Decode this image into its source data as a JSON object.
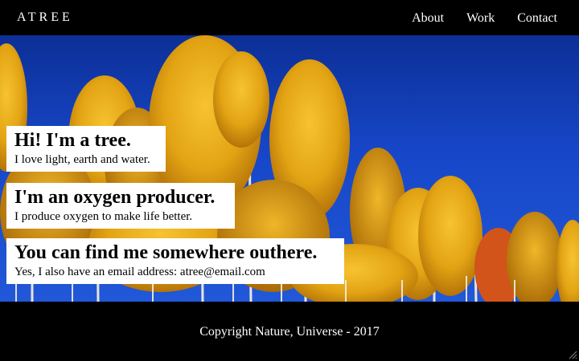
{
  "header": {
    "brand": "ATREE",
    "nav": [
      "About",
      "Work",
      "Contact"
    ]
  },
  "hero": {
    "cards": [
      {
        "title": "Hi! I'm a tree.",
        "text": "I love light, earth and water."
      },
      {
        "title": "I'm an oxygen producer.",
        "text": "I produce oxygen to make life better."
      },
      {
        "title": "You can find me somewhere outhere.",
        "text": "Yes, I also have an email address: atree@email.com"
      }
    ]
  },
  "footer": {
    "copyright": "Copyright Nature, Universe - 2017"
  },
  "colors": {
    "sky": "#1747c9",
    "foliage": "#e5a612",
    "foliage_dark": "#c57c07",
    "bars": "#000000",
    "text_light": "#ffffff"
  }
}
